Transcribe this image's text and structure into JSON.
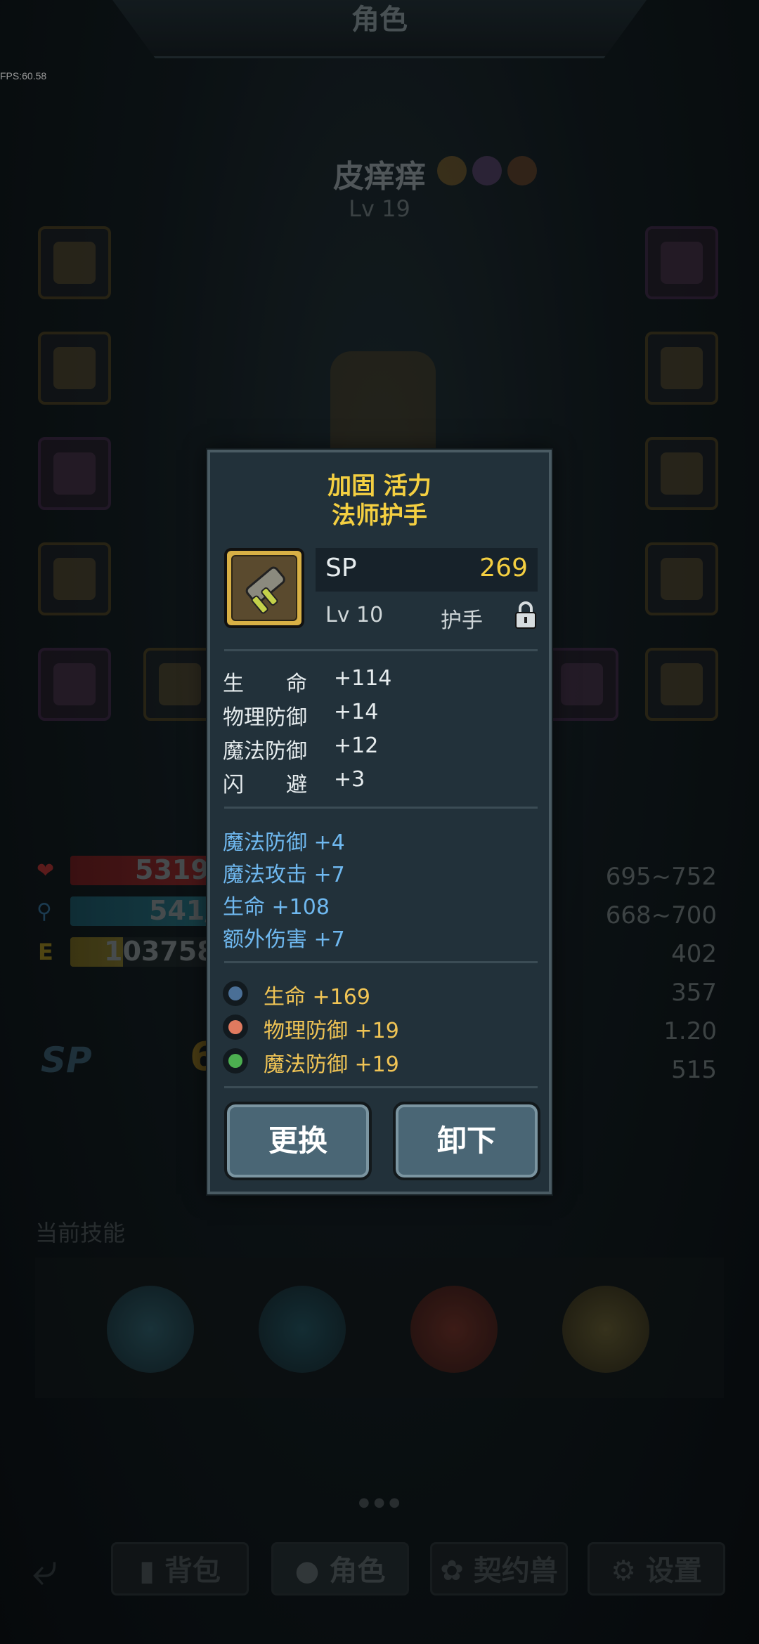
{
  "header": {
    "title": "角色",
    "fps": "FPS:60.58"
  },
  "character": {
    "name": "皮痒痒",
    "level": "Lv 19"
  },
  "stats_bars": {
    "hp": "5319/",
    "mp": "541/",
    "exp": "103758/"
  },
  "right_stats": [
    "695~752",
    "668~700",
    "402",
    "357",
    "1.20",
    "515"
  ],
  "sp_area": {
    "label": "SP",
    "value": "6"
  },
  "skills": {
    "title": "当前技能"
  },
  "nav": {
    "back": "",
    "bag": "背包",
    "role": "角色",
    "pet": "契约兽",
    "settings": "设置"
  },
  "item": {
    "name_line1": "加固 活力",
    "name_line2": "法师护手",
    "sp_label": "SP",
    "sp_value": "269",
    "level": "Lv 10",
    "slot_type": "护手",
    "base_stats": [
      {
        "label": "生　　命",
        "value": "+114"
      },
      {
        "label": "物理防御",
        "value": "+14"
      },
      {
        "label": "魔法防御",
        "value": "+12"
      },
      {
        "label": "闪　　避",
        "value": "+3"
      }
    ],
    "extra_stats": [
      "魔法防御 +4",
      "魔法攻击 +7",
      "生命 +108",
      "额外伤害 +7"
    ],
    "gem_stats": [
      {
        "text": "生命 +169",
        "color": "#3b5f86"
      },
      {
        "text": "物理防御 +19",
        "color": "#e07a5f"
      },
      {
        "text": "魔法防御 +19",
        "color": "#4caf50"
      }
    ]
  },
  "buttons": {
    "replace": "更换",
    "unequip": "卸下"
  },
  "colors": {
    "gold": "#f4cf41",
    "blue": "#6fb8ef",
    "gem_text": "#f0c455",
    "panel": "#22313a"
  }
}
